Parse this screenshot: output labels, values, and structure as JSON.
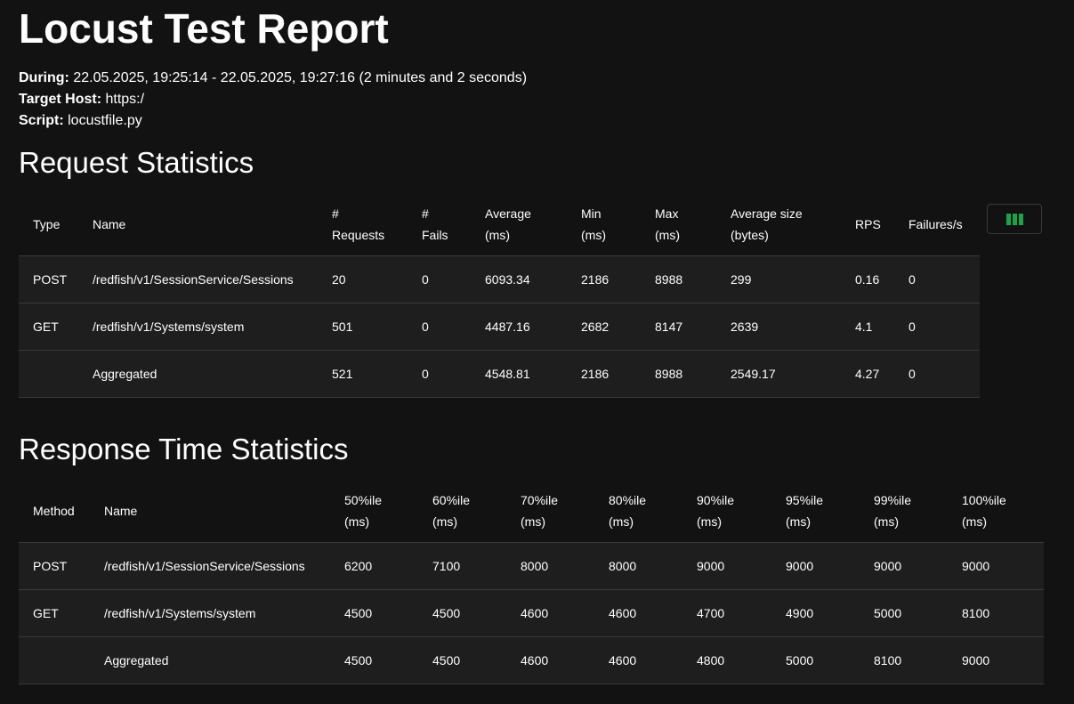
{
  "report": {
    "title": "Locust Test Report",
    "during_label": "During:",
    "during_value": " 22.05.2025, 19:25:14 - 22.05.2025, 19:27:16 (2 minutes and 2 seconds)",
    "host_label": "Target Host:",
    "host_value": " https:/",
    "script_label": "Script:",
    "script_value": " locustfile.py"
  },
  "request_stats": {
    "title": "Request Statistics",
    "columns_button_icon": "view-columns-icon",
    "accent_color": "#1aa34a",
    "headers": {
      "type": "Type",
      "name": "Name",
      "requests_1": "#",
      "requests_2": "Requests",
      "fails_1": "#",
      "fails_2": "Fails",
      "avg_1": "Average",
      "avg_2": "(ms)",
      "min_1": "Min",
      "min_2": "(ms)",
      "max_1": "Max",
      "max_2": "(ms)",
      "size_1": "Average size",
      "size_2": "(bytes)",
      "rps": "RPS",
      "failures": "Failures/s"
    },
    "rows": [
      {
        "type": "POST",
        "name": "/redfish/v1/SessionService/Sessions",
        "requests": "20",
        "fails": "0",
        "avg": "6093.34",
        "min": "2186",
        "max": "8988",
        "size": "299",
        "rps": "0.16",
        "failures": "0"
      },
      {
        "type": "GET",
        "name": "/redfish/v1/Systems/system",
        "requests": "501",
        "fails": "0",
        "avg": "4487.16",
        "min": "2682",
        "max": "8147",
        "size": "2639",
        "rps": "4.1",
        "failures": "0"
      },
      {
        "type": "",
        "name": "Aggregated",
        "requests": "521",
        "fails": "0",
        "avg": "4548.81",
        "min": "2186",
        "max": "8988",
        "size": "2549.17",
        "rps": "4.27",
        "failures": "0"
      }
    ]
  },
  "response_stats": {
    "title": "Response Time Statistics",
    "headers": {
      "method": "Method",
      "name": "Name",
      "p50": "50%ile",
      "p60": "60%ile",
      "p70": "70%ile",
      "p80": "80%ile",
      "p90": "90%ile",
      "p95": "95%ile",
      "p99": "99%ile",
      "p100": "100%ile",
      "unit": "(ms)"
    },
    "rows": [
      {
        "method": "POST",
        "name": "/redfish/v1/SessionService/Sessions",
        "p50": "6200",
        "p60": "7100",
        "p70": "8000",
        "p80": "8000",
        "p90": "9000",
        "p95": "9000",
        "p99": "9000",
        "p100": "9000"
      },
      {
        "method": "GET",
        "name": "/redfish/v1/Systems/system",
        "p50": "4500",
        "p60": "4500",
        "p70": "4600",
        "p80": "4600",
        "p90": "4700",
        "p95": "4900",
        "p99": "5000",
        "p100": "8100"
      },
      {
        "method": "",
        "name": "Aggregated",
        "p50": "4500",
        "p60": "4500",
        "p70": "4600",
        "p80": "4600",
        "p90": "4800",
        "p95": "5000",
        "p99": "8100",
        "p100": "9000"
      }
    ]
  }
}
